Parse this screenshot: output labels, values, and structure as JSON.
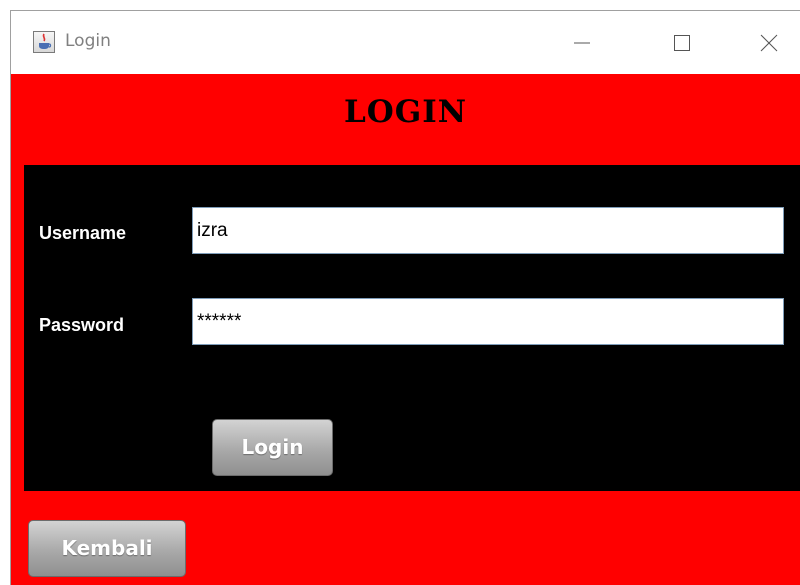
{
  "window": {
    "title": "Login",
    "app_icon": "java-cup-icon",
    "controls": [
      "minimize-icon",
      "maximize-icon",
      "close-icon"
    ]
  },
  "header": {
    "title": "LOGIN"
  },
  "form": {
    "username_label": "Username",
    "username_value": "izra",
    "password_label": "Password",
    "password_value": "******",
    "login_button": "Login"
  },
  "footer": {
    "back_button": "Kembali"
  },
  "colors": {
    "background": "#ff0000",
    "panel": "#000000",
    "button": "#a9a9a9"
  }
}
